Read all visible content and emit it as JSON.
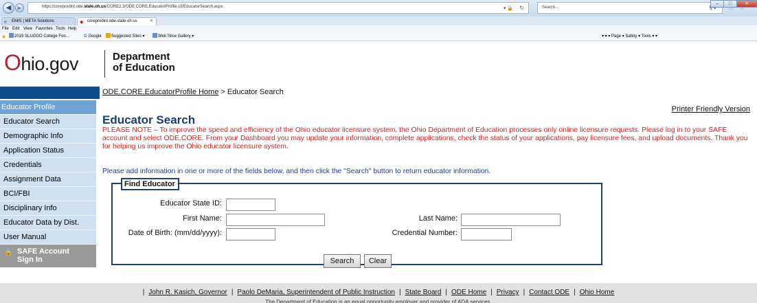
{
  "browser": {
    "url_prefix": "https://coreprodint.ode.",
    "url_domain": "state.oh.us",
    "url_path": "/CORE2.3/ODE.CORE.EducatorProfile.UI/EducatorSearch.aspx",
    "search_placeholder": "Search...",
    "tabs": [
      {
        "label": "EMIS | META Solutions"
      },
      {
        "label": "coreprodint.ode.state.oh.us"
      }
    ],
    "menu": [
      "File",
      "Edit",
      "View",
      "Favorites",
      "Tools",
      "Help"
    ],
    "favorites": [
      {
        "label": "2015 SLUGGO College Foo..."
      },
      {
        "label": "Google"
      },
      {
        "label": "Suggested Sites ▾"
      },
      {
        "label": "Web Slice Gallery ▾"
      }
    ],
    "command_bar": "▾  ▾ ▾  Page ▾  Safety ▾  Tools ▾  ▾"
  },
  "header": {
    "logo_o": "O",
    "logo_rest": "hio.gov",
    "dept_line1": "Department",
    "dept_line2": "of Education"
  },
  "breadcrumb": {
    "home_link": "ODE.CORE.EducatorProfile Home",
    "separator": " > ",
    "current": "Educator Search"
  },
  "sidebar": {
    "header": "Educator Profile",
    "items": [
      {
        "label": "Educator Search"
      },
      {
        "label": "Demographic Info"
      },
      {
        "label": "Application Status"
      },
      {
        "label": "Credentials"
      },
      {
        "label": "Assignment Data"
      },
      {
        "label": "BCI/FBI"
      },
      {
        "label": "Disciplinary Info"
      },
      {
        "label": "Educator Data by Dist."
      },
      {
        "label": "User Manual"
      }
    ],
    "safe_line1": "SAFE Account",
    "safe_line2": "Sign In"
  },
  "main": {
    "printer_link": "Printer Friendly Version",
    "title": "Educator Search",
    "notice": "PLEASE NOTE – To improve the speed and efficiency of the Ohio educator licensure system, the Ohio Department of Education processes only online licensure requests. Please log in to your SAFE account and select ODE.CORE. From your Dashboard you may update your information, complete applications, check the status of your applications, pay licensure fees, and upload documents. Thank you for helping us improve the Ohio educator licensure system.",
    "instructions": "Please add information in one or more of the fields below, and then click the \"Search\" button to return educator information."
  },
  "form": {
    "legend": "Find Educator",
    "state_id_label": "Educator State ID:",
    "first_name_label": "First Name:",
    "last_name_label": "Last Name:",
    "dob_label": "Date of Birth: (mm/dd/yyyy):",
    "credential_label": "Credential Number:",
    "state_id_value": "",
    "first_name_value": "",
    "last_name_value": "",
    "dob_value": "",
    "credential_value": "",
    "search_button": "Search",
    "clear_button": "Clear"
  },
  "footer": {
    "links": [
      "John R. Kasich, Governor",
      "Paolo DeMaria, Superintendent of Public Instruction",
      "State Board",
      "ODE Home",
      "Privacy",
      "Contact ODE",
      "Ohio Home"
    ],
    "separator": "|",
    "note": "The Department of Education is an equal opportunity employer and provider of ADA services."
  },
  "colors": {
    "sidebar_bg": "#cfe0f1",
    "sidebar_header": "#6fa2d6",
    "brand_blue": "#0e4d8c",
    "notice_red": "#e31b1b",
    "title_blue": "#1a3d78"
  }
}
